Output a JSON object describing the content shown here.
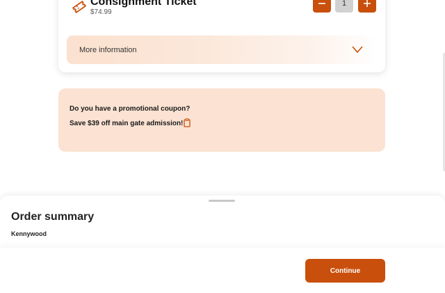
{
  "ticket": {
    "title": "Consignment Ticket",
    "price": "$74.99",
    "quantity": "1",
    "more_info_label": "More information",
    "icon": "ticket-icon",
    "accent_color": "#c94f0c"
  },
  "promo": {
    "question": "Do you have a promotional coupon?",
    "offer": "Save $39 off main gate admission!",
    "icon": "clipboard-icon",
    "background_color": "#fbe2d2"
  },
  "summary": {
    "title": "Order summary",
    "park": "Kennywood"
  },
  "footer": {
    "continue_label": "Continue"
  }
}
